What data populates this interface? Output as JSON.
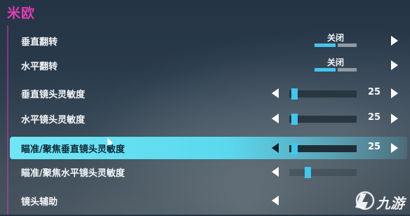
{
  "page_title": "米欧",
  "settings": [
    {
      "label": "垂直翻转",
      "type": "toggle",
      "value_text": "关闭"
    },
    {
      "label": "水平翻转",
      "type": "toggle",
      "value_text": "关闭"
    },
    {
      "label": "垂直镜头灵敏度",
      "type": "slider",
      "value": "25"
    },
    {
      "label": "水平镜头灵敏度",
      "type": "slider",
      "value": "25"
    },
    {
      "label": "瞄准/聚焦垂直镜头灵敏度",
      "type": "slider",
      "value": "25",
      "selected": true
    },
    {
      "label": "瞄准/聚焦水平镜头灵敏度",
      "type": "slider"
    },
    {
      "label": "镜头辅助",
      "type": "option"
    }
  ],
  "watermark": {
    "text": "九游",
    "icon": "jiuyou-logo-icon"
  },
  "colors": {
    "accent_pink": "#e23ab5",
    "accent_cyan": "#42c6ee",
    "selected_row": "#5bd8ee"
  }
}
